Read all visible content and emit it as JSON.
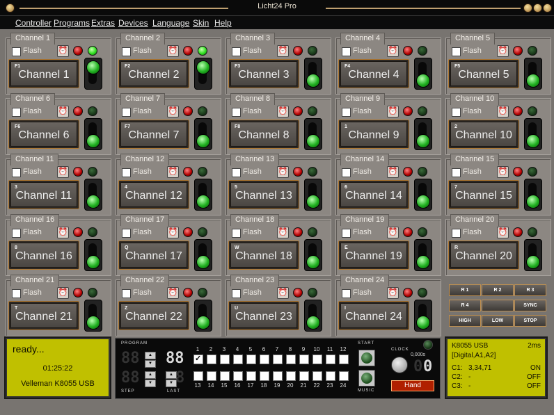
{
  "window": {
    "title": "Licht24 Pro"
  },
  "menu": [
    "Controller",
    "Programs",
    "Extras",
    "Devices",
    "Language",
    "Skin",
    "Help"
  ],
  "channels": [
    {
      "tab": "Channel 1",
      "flash": "Flash",
      "key": "F1",
      "name": "Channel 1",
      "active": true
    },
    {
      "tab": "Channel 2",
      "flash": "Flash",
      "key": "F2",
      "name": "Channel 2",
      "active": true
    },
    {
      "tab": "Channel 3",
      "flash": "Flash",
      "key": "F3",
      "name": "Channel 3",
      "active": false
    },
    {
      "tab": "Channel 4",
      "flash": "Flash",
      "key": "F4",
      "name": "Channel 4",
      "active": false
    },
    {
      "tab": "Channel 5",
      "flash": "Flash",
      "key": "F5",
      "name": "Channel 5",
      "active": false
    },
    {
      "tab": "Channel 6",
      "flash": "Flash",
      "key": "F6",
      "name": "Channel 6",
      "active": false
    },
    {
      "tab": "Channel 7",
      "flash": "Flash",
      "key": "F7",
      "name": "Channel 7",
      "active": false
    },
    {
      "tab": "Channel 8",
      "flash": "Flash",
      "key": "F8",
      "name": "Channel 8",
      "active": false
    },
    {
      "tab": "Channel 9",
      "flash": "Flash",
      "key": "1",
      "name": "Channel 9",
      "active": false
    },
    {
      "tab": "Channel 10",
      "flash": "Flash",
      "key": "2",
      "name": "Channel 10",
      "active": false
    },
    {
      "tab": "Channel 11",
      "flash": "Flash",
      "key": "3",
      "name": "Channel 11",
      "active": false
    },
    {
      "tab": "Channel 12",
      "flash": "Flash",
      "key": "4",
      "name": "Channel 12",
      "active": false
    },
    {
      "tab": "Channel 13",
      "flash": "Flash",
      "key": "5",
      "name": "Channel 13",
      "active": false
    },
    {
      "tab": "Channel 14",
      "flash": "Flash",
      "key": "6",
      "name": "Channel 14",
      "active": false
    },
    {
      "tab": "Channel 15",
      "flash": "Flash",
      "key": "7",
      "name": "Channel 15",
      "active": false
    },
    {
      "tab": "Channel 16",
      "flash": "Flash",
      "key": "8",
      "name": "Channel 16",
      "active": false
    },
    {
      "tab": "Channel 17",
      "flash": "Flash",
      "key": "Q",
      "name": "Channel 17",
      "active": false
    },
    {
      "tab": "Channel 18",
      "flash": "Flash",
      "key": "W",
      "name": "Channel 18",
      "active": false
    },
    {
      "tab": "Channel 19",
      "flash": "Flash",
      "key": "E",
      "name": "Channel 19",
      "active": false
    },
    {
      "tab": "Channel 20",
      "flash": "Flash",
      "key": "R",
      "name": "Channel 20",
      "active": false
    },
    {
      "tab": "Channel 21",
      "flash": "Flash",
      "key": "T",
      "name": "Channel 21",
      "active": false
    },
    {
      "tab": "Channel 22",
      "flash": "Flash",
      "key": "Z",
      "name": "Channel 22",
      "active": false
    },
    {
      "tab": "Channel 23",
      "flash": "Flash",
      "key": "U",
      "name": "Channel 23",
      "active": false
    },
    {
      "tab": "Channel 24",
      "flash": "Flash",
      "key": "I",
      "name": "Channel 24",
      "active": false
    }
  ],
  "relay_buttons": [
    "R 1",
    "R 2",
    "R 3",
    "R 4",
    "",
    "SYNC",
    "HIGH",
    "LOW",
    "STOP"
  ],
  "status_lcd": {
    "line1": "ready...",
    "time": "01:25:22",
    "device": "Velleman K8055 USB"
  },
  "program": {
    "program_label": "PROGRAM",
    "step_label": "STEP",
    "last_label": "LAST",
    "program_value": "88",
    "step_value": "88",
    "last_value": "8",
    "numbers_top": [
      "1",
      "2",
      "3",
      "4",
      "5",
      "6",
      "7",
      "8",
      "9",
      "10",
      "11",
      "12"
    ],
    "numbers_bottom": [
      "13",
      "14",
      "15",
      "16",
      "17",
      "18",
      "19",
      "20",
      "21",
      "22",
      "23",
      "24"
    ],
    "checked": [
      1
    ],
    "start_label": "START",
    "music_label": "MUSIC",
    "clock_label": "CLOCK",
    "clock_value": "0,000s",
    "clock_digit": "0",
    "hand_label": "Hand"
  },
  "device_lcd": {
    "line1_left": "K8055 USB",
    "line1_right": "2ms",
    "line2": "[Digital,A1,A2]",
    "rows": [
      {
        "label": "C1:",
        "value": "3,34,71",
        "state": "ON"
      },
      {
        "label": "C2:",
        "value": "-",
        "state": "OFF"
      },
      {
        "label": "C3:",
        "value": "-",
        "state": "OFF"
      }
    ]
  },
  "icons": {
    "clock": "alarm-clock-icon",
    "led_red": "red-led",
    "led_green": "green-led",
    "close": "close-icon"
  }
}
